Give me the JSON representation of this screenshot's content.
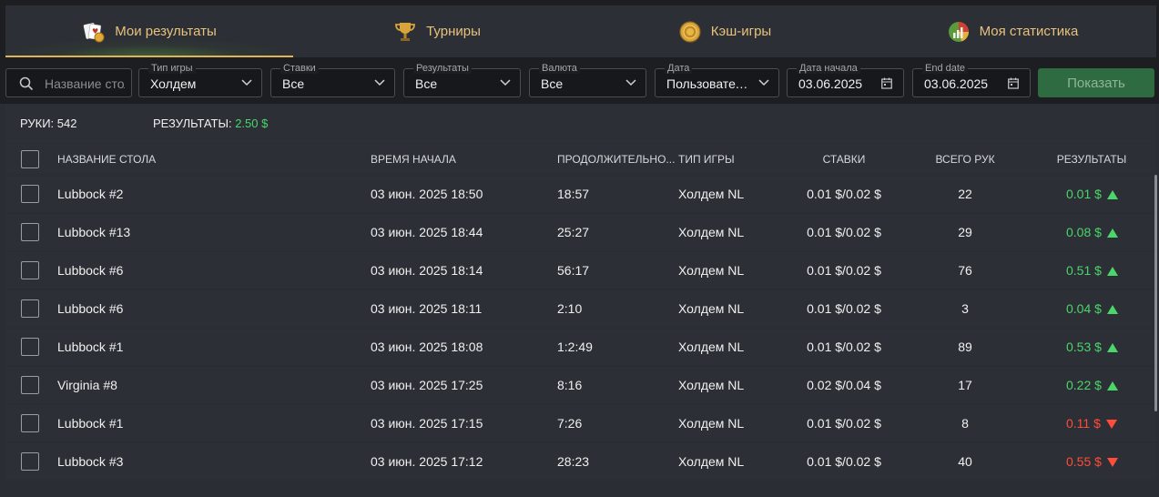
{
  "tabs": [
    {
      "label": "Мои результаты",
      "icon": "cards-icon",
      "active": true
    },
    {
      "label": "Турниры",
      "icon": "trophy-icon",
      "active": false
    },
    {
      "label": "Кэш-игры",
      "icon": "chip-icon",
      "active": false
    },
    {
      "label": "Моя статистика",
      "icon": "stats-chart-icon",
      "active": false
    }
  ],
  "filters": {
    "search_placeholder": "Название стола",
    "game_type": {
      "label": "Тип игры",
      "value": "Холдем"
    },
    "stakes": {
      "label": "Ставки",
      "value": "Все"
    },
    "results": {
      "label": "Результаты",
      "value": "Все"
    },
    "currency": {
      "label": "Валюта",
      "value": "Все"
    },
    "date": {
      "label": "Дата",
      "value": "Пользовательский"
    },
    "start_date": {
      "label": "Дата начала",
      "value": "03.06.2025"
    },
    "end_date": {
      "label": "End date",
      "value": "03.06.2025"
    },
    "show_button": "Показать"
  },
  "summary": {
    "hands_label": "РУКИ:",
    "hands_value": "542",
    "results_label": "РЕЗУЛЬТАТЫ:",
    "results_value": "2.50 $"
  },
  "columns": {
    "table_name": "НАЗВАНИЕ СТОЛА",
    "start_time": "ВРЕМЯ НАЧАЛА",
    "duration": "ПРОДОЛЖИТЕЛЬНО...",
    "game_type": "ТИП ИГРЫ",
    "stakes": "СТАВКИ",
    "total_hands": "ВСЕГО РУК",
    "results": "РЕЗУЛЬТАТЫ"
  },
  "rows": [
    {
      "name": "Lubbock #2",
      "start": "03 июн. 2025 18:50",
      "duration": "18:57",
      "game": "Холдем NL",
      "stakes": "0.01 $/0.02 $",
      "hands": "22",
      "result": "0.01 $",
      "trend": "up"
    },
    {
      "name": "Lubbock #13",
      "start": "03 июн. 2025 18:44",
      "duration": "25:27",
      "game": "Холдем NL",
      "stakes": "0.01 $/0.02 $",
      "hands": "29",
      "result": "0.08 $",
      "trend": "up"
    },
    {
      "name": "Lubbock #6",
      "start": "03 июн. 2025 18:14",
      "duration": "56:17",
      "game": "Холдем NL",
      "stakes": "0.01 $/0.02 $",
      "hands": "76",
      "result": "0.51 $",
      "trend": "up"
    },
    {
      "name": "Lubbock #6",
      "start": "03 июн. 2025 18:11",
      "duration": "2:10",
      "game": "Холдем NL",
      "stakes": "0.01 $/0.02 $",
      "hands": "3",
      "result": "0.04 $",
      "trend": "up"
    },
    {
      "name": "Lubbock #1",
      "start": "03 июн. 2025 18:08",
      "duration": "1:2:49",
      "game": "Холдем NL",
      "stakes": "0.01 $/0.02 $",
      "hands": "89",
      "result": "0.53 $",
      "trend": "up"
    },
    {
      "name": "Virginia #8",
      "start": "03 июн. 2025 17:25",
      "duration": "8:16",
      "game": "Холдем NL",
      "stakes": "0.02 $/0.04 $",
      "hands": "17",
      "result": "0.22 $",
      "trend": "up"
    },
    {
      "name": "Lubbock #1",
      "start": "03 июн. 2025 17:15",
      "duration": "7:26",
      "game": "Холдем NL",
      "stakes": "0.01 $/0.02 $",
      "hands": "8",
      "result": "0.11 $",
      "trend": "down"
    },
    {
      "name": "Lubbock #3",
      "start": "03 июн. 2025 17:12",
      "duration": "28:23",
      "game": "Холдем NL",
      "stakes": "0.01 $/0.02 $",
      "hands": "40",
      "result": "0.55 $",
      "trend": "down"
    }
  ],
  "colors": {
    "accent_gold": "#e8c27a",
    "positive": "#4bd66a",
    "negative": "#ff4d3a",
    "button_green": "#2e6b40"
  }
}
